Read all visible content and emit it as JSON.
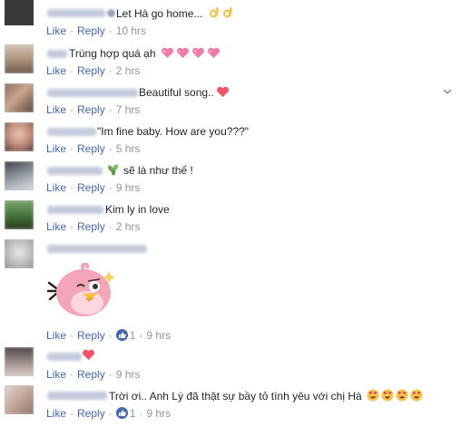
{
  "comments": [
    {
      "text": "Let Hà go home...",
      "actions": {
        "like": "Like",
        "reply": "Reply",
        "time": "10 hrs"
      }
    },
    {
      "text": "Trùng hợp quá ạh",
      "actions": {
        "like": "Like",
        "reply": "Reply",
        "time": "2 hrs"
      }
    },
    {
      "text": "Beautiful song..",
      "actions": {
        "like": "Like",
        "reply": "Reply",
        "time": "7 hrs"
      }
    },
    {
      "text": "\"Im fine baby. How are you???\"",
      "actions": {
        "like": "Like",
        "reply": "Reply",
        "time": "5 hrs"
      }
    },
    {
      "text": "sẽ là như thế !",
      "actions": {
        "like": "Like",
        "reply": "Reply",
        "time": "9 hrs"
      }
    },
    {
      "text": "Kim ly in love",
      "actions": {
        "like": "Like",
        "reply": "Reply",
        "time": "2 hrs"
      }
    },
    {
      "text": "",
      "sticker": "angry-bird-pink-sticker",
      "actions": {
        "like": "Like",
        "reply": "Reply",
        "reactions": "1",
        "time": "9 hrs"
      }
    },
    {
      "text": "",
      "actions": {
        "like": "Like",
        "reply": "Reply",
        "time": "9 hrs"
      }
    },
    {
      "text": "Trời ơi.. Anh Lý đã thật sự bầy tỏ tình yêu với chị Hà",
      "actions": {
        "like": "Like",
        "reply": "Reply",
        "reactions": "1",
        "time": "9 hrs"
      }
    }
  ],
  "colors": {
    "link": "#4267b2",
    "meta": "#90949c",
    "heart": "#f25268"
  },
  "icons": [
    "ok-hand-icon",
    "sparkling-heart-icon",
    "heart-icon",
    "herb-icon",
    "like-reaction-icon",
    "heart-eyes-icon",
    "chevron-down-icon"
  ]
}
